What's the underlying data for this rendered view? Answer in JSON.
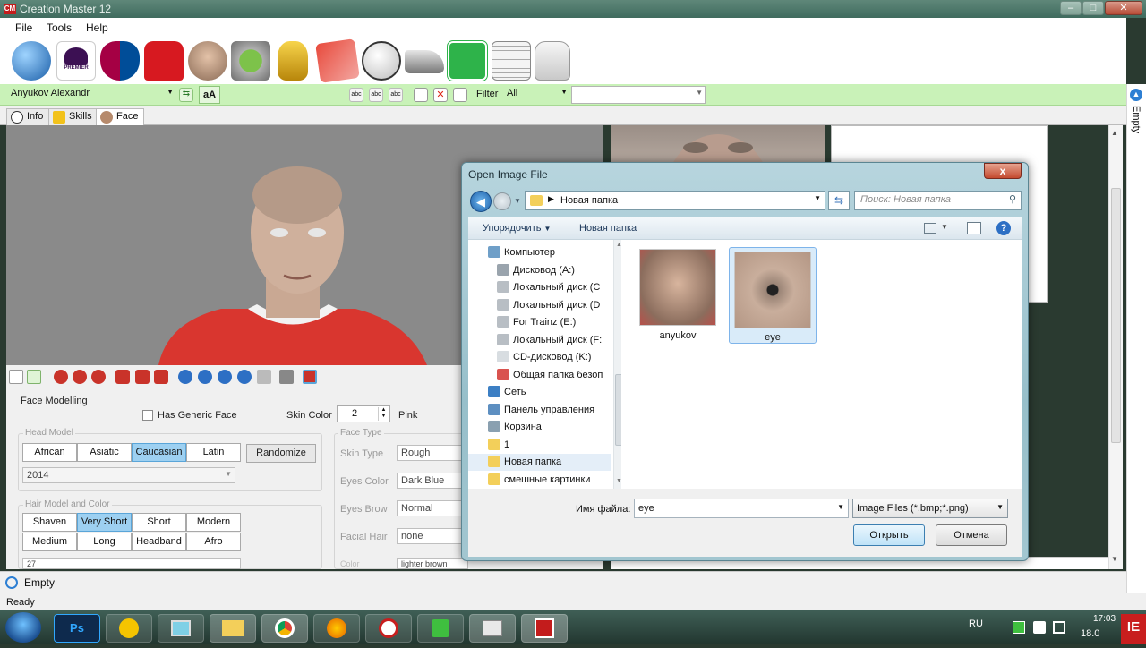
{
  "window": {
    "title": "Creation Master 12",
    "minimize": "–",
    "maximize": "□",
    "close": "✕"
  },
  "menu": [
    "File",
    "Tools",
    "Help"
  ],
  "toolbar_icons": [
    "globe-icon",
    "premier-league-icon",
    "fc-barcelona-icon",
    "shirt-icon",
    "player-icon",
    "stadium-icon",
    "world-cup-icon",
    "cards-icon",
    "ball-icon",
    "boot-icon",
    "pitch-icon",
    "newspaper-icon",
    "glove-icon"
  ],
  "filterbar": {
    "player": "Anyukov Alexandr",
    "case_button": "aA",
    "filter_label": "Filter",
    "filter_value": "All",
    "filter_value2": ""
  },
  "tabs": [
    "Info",
    "Skills",
    "Face"
  ],
  "face_panel": {
    "face_modelling": "Face Modelling",
    "has_generic_face": "Has Generic Face",
    "skin_color_label": "Skin Color",
    "skin_color_value": "2",
    "skin_color_name": "Pink",
    "head_model_label": "Head Model",
    "head_models": [
      "African",
      "Asiatic",
      "Caucasian",
      "Latin"
    ],
    "selected_head": "Caucasian",
    "randomize": "Randomize",
    "head_year": "2014",
    "hair_model_label": "Hair Model and Color",
    "hair_models": [
      "Shaven",
      "Very Short",
      "Short",
      "Modern",
      "Medium",
      "Long",
      "Headband",
      "Afro"
    ],
    "selected_hair": "Very Short",
    "hair_value": "27",
    "face_type_label": "Face Type",
    "skin_type_label": "Skin Type",
    "skin_type_value": "Rough",
    "eyes_color_label": "Eyes Color",
    "eyes_color_value": "Dark Blue",
    "eyes_brow_label": "Eyes Brow",
    "eyes_brow_value": "Normal",
    "facial_hair_label": "Facial Hair",
    "facial_hair_value": "none",
    "color_label": "Color",
    "color_value": "lighter brown"
  },
  "sidebar_label": "Empty",
  "status_empty": "Empty",
  "status_ready": "Ready",
  "dialog": {
    "title": "Open Image File",
    "close": "x",
    "address": "Новая папка",
    "search_placeholder": "Поиск: Новая папка",
    "organize": "Упорядочить",
    "new_folder": "Новая папка",
    "nav_items": [
      {
        "label": "Компьютер",
        "icon": "computer-icon",
        "indent": 1
      },
      {
        "label": "Дисковод (A:)",
        "icon": "floppy-icon",
        "indent": 2
      },
      {
        "label": "Локальный диск (C",
        "icon": "disk-icon",
        "indent": 2
      },
      {
        "label": "Локальный диск (D",
        "icon": "disk-icon",
        "indent": 2
      },
      {
        "label": "For Trainz (E:)",
        "icon": "disk-icon",
        "indent": 2
      },
      {
        "label": "Локальный диск (F:",
        "icon": "disk-icon",
        "indent": 2
      },
      {
        "label": "CD-дисковод (K:)",
        "icon": "cd-icon",
        "indent": 2
      },
      {
        "label": "Общая папка безоп",
        "icon": "shared-folder-icon",
        "indent": 2
      },
      {
        "label": "Сеть",
        "icon": "network-icon",
        "indent": 1
      },
      {
        "label": "Панель управления",
        "icon": "control-panel-icon",
        "indent": 1
      },
      {
        "label": "Корзина",
        "icon": "recycle-bin-icon",
        "indent": 1
      },
      {
        "label": "1",
        "icon": "folder-icon",
        "indent": 1
      },
      {
        "label": "Новая папка",
        "icon": "folder-icon",
        "indent": 1
      },
      {
        "label": "смешные картинки",
        "icon": "folder-icon",
        "indent": 1
      }
    ],
    "selected_nav": "Новая папка",
    "files": [
      {
        "name": "anyukov"
      },
      {
        "name": "eye"
      }
    ],
    "selected_file": "eye",
    "filename_label": "Имя файла:",
    "filename_value": "eye",
    "filetype": "Image Files (*.bmp;*.png)",
    "open": "Открыть",
    "cancel": "Отмена"
  },
  "taskbar": {
    "apps": [
      "start-orb",
      "photoshop-icon",
      "norton-icon",
      "computer-icon",
      "explorer-icon",
      "chrome-icon",
      "firefox-icon",
      "clock-app-icon",
      "trainz-icon",
      "mspaint-icon",
      "creation-master-icon"
    ],
    "ps_label": "Ps",
    "lang": "RU",
    "time": "17:03",
    "date": "18.0"
  }
}
